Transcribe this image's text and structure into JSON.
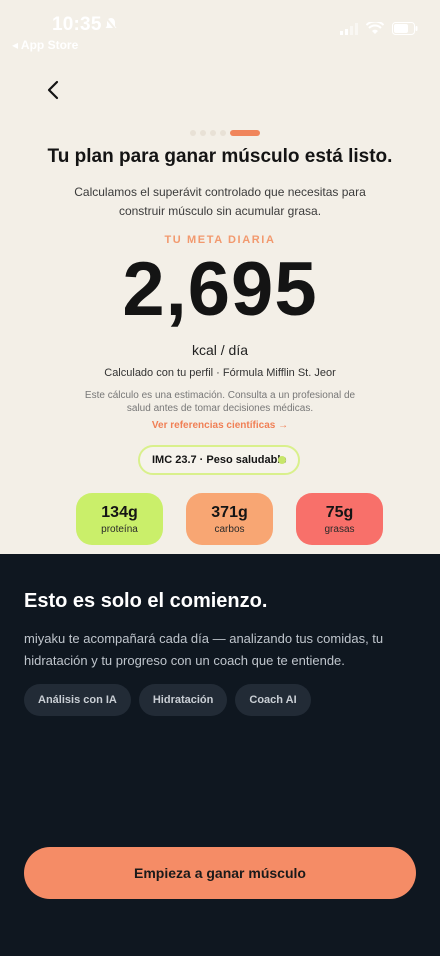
{
  "status_bar": {
    "time": "10:35",
    "back_app": "◂ App Store"
  },
  "header": {
    "back_icon": "chevron-left-icon"
  },
  "plan": {
    "title": "Tu plan para ganar músculo está listo.",
    "subtitle": "Calculamos el superávit controlado que necesitas para construir músculo sin acumular grasa.",
    "meta_label": "TU META DIARIA",
    "calories": "2,695",
    "unit": "kcal / día",
    "calc_note": "Calculado con tu perfil · Fórmula Mifflin St. Jeor",
    "disclaimer": "Este cálculo es una estimación. Consulta a un profesional de salud antes de tomar decisiones médicas.",
    "refs_link": "Ver referencias científicas →",
    "imc": "IMC 23.7 · Peso saludable"
  },
  "macros": [
    {
      "value": "134g",
      "label": "proteína",
      "color": "#CAEF6A"
    },
    {
      "value": "371g",
      "label": "carbos",
      "color": "#F8A673"
    },
    {
      "value": "75g",
      "label": "grasas",
      "color": "#F8706A"
    }
  ],
  "bottom": {
    "title": "Esto es solo el comienzo.",
    "text": "miyaku te acompañará cada día — analizando tus comidas, tu hidratación y tu progreso con un coach que te entiende.",
    "chips": [
      "Análisis con IA",
      "Hidratación",
      "Coach AI"
    ],
    "cta": "Empieza a ganar músculo"
  },
  "colors": {
    "accent": "#F58C66",
    "background": "#F3EFE7",
    "dark": "#0F1720"
  }
}
